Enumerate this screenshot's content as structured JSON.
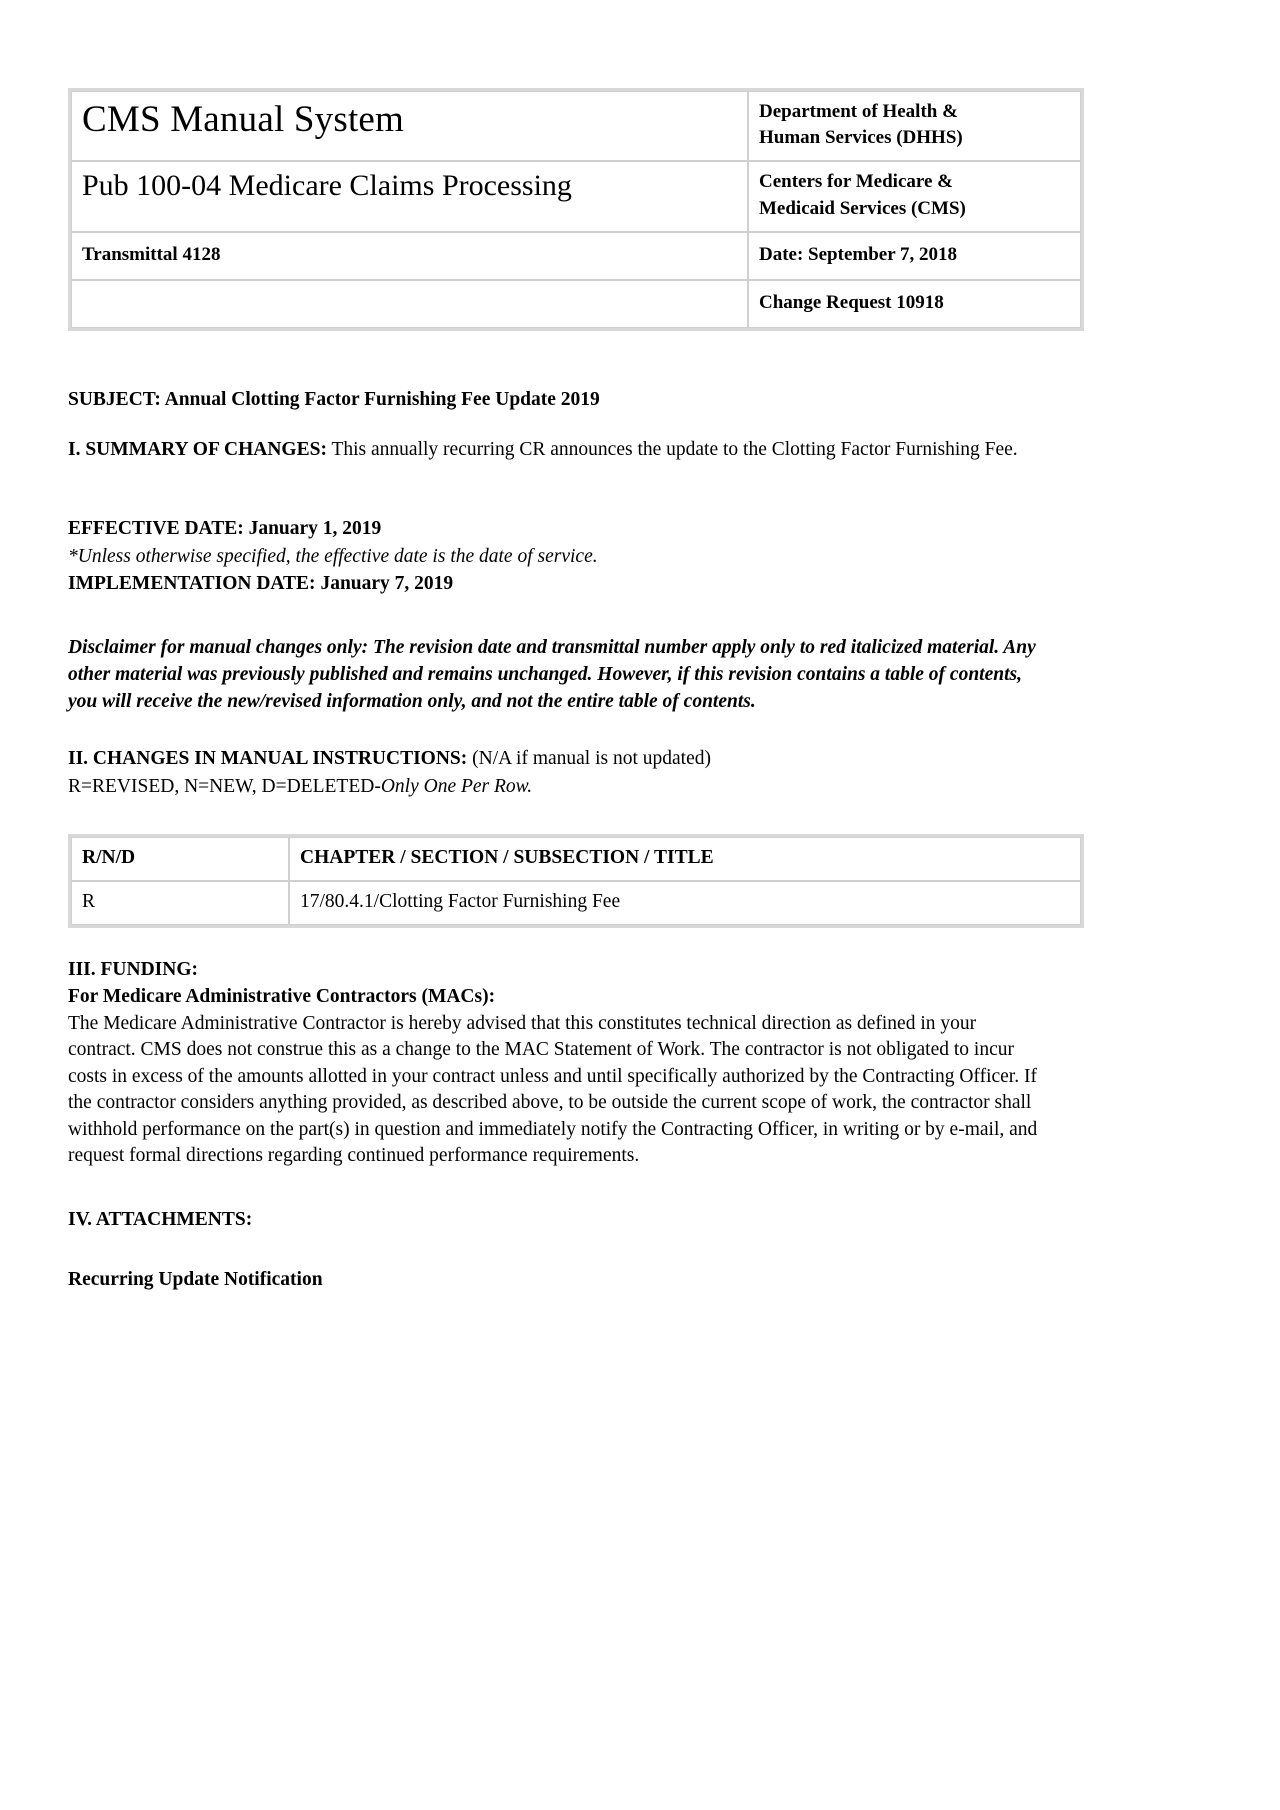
{
  "document": {
    "header": {
      "manual_system_title": "CMS Manual System",
      "publication_title": "Pub 100-04 Medicare Claims Processing",
      "transmittal": "Transmittal 4128",
      "blank_cell": "",
      "department_line1": "Department of Health &",
      "department_line2": "Human Services (DHHS)",
      "agency_line1": "Centers for Medicare &",
      "agency_line2": "Medicaid Services (CMS)",
      "date": "Date: September 7, 2018",
      "change_request": "Change Request 10918"
    },
    "subject": {
      "label": "SUBJECT:",
      "text": " Annual Clotting Factor Furnishing Fee Update 2019"
    },
    "summary": {
      "label": "I. SUMMARY OF CHANGES:",
      "text": " This annually recurring CR announces the update to the Clotting Factor Furnishing Fee."
    },
    "dates": {
      "effective_label": "EFFECTIVE DATE:",
      "effective_value": " January 1, 2019",
      "effective_note": "*Unless otherwise specified, the effective date is the date of service.",
      "implementation_label": "IMPLEMENTATION DATE:",
      "implementation_value": " January 7, 2019"
    },
    "disclaimer": "Disclaimer for manual changes only: The revision date and transmittal number apply only to red italicized material. Any other material was previously published and remains unchanged. However, if this revision contains a table of contents, you will receive the new/revised information only, and not the entire table of contents.",
    "changes_section": {
      "heading_label": "II. CHANGES IN MANUAL INSTRUCTIONS:",
      "heading_note": " (N/A if manual is not updated)",
      "legend_plain": "R=REVISED, N=NEW, D=DELETED-",
      "legend_italic": "Only One Per Row.",
      "table": {
        "columns": [
          "R/N/D",
          "CHAPTER / SECTION / SUBSECTION / TITLE"
        ],
        "rows": [
          [
            "R",
            "17/80.4.1/Clotting Factor Furnishing Fee"
          ]
        ]
      }
    },
    "funding": {
      "heading": "III. FUNDING:",
      "subheading": "For Medicare Administrative Contractors (MACs):",
      "body": "The Medicare Administrative Contractor is hereby advised that this constitutes technical direction as defined in your contract. CMS does not construe this as a change to the MAC Statement of Work. The contractor is not obligated to incur costs in excess of the amounts allotted in your contract unless and until specifically authorized by the Contracting Officer. If the contractor considers anything provided, as described above, to be outside the current scope of work, the contractor shall withhold performance on the part(s) in question and immediately notify the Contracting Officer, in writing or by e-mail, and request formal directions regarding continued performance requirements."
    },
    "attachments": {
      "heading": "IV. ATTACHMENTS:",
      "items": [
        "Recurring Update Notification"
      ]
    }
  }
}
